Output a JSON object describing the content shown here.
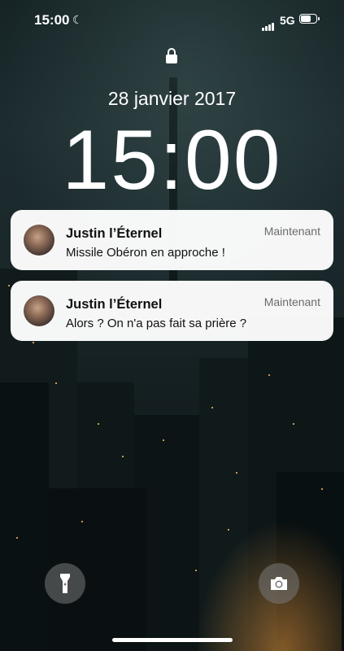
{
  "status_bar": {
    "time": "15:00",
    "network": "5G",
    "moon_icon": "moon-icon",
    "battery_level": 0.7
  },
  "lock_screen": {
    "date": "28 janvier 2017",
    "time": "15:00"
  },
  "notifications": [
    {
      "sender": "Justin l’Éternel",
      "message": "Missile Obéron en approche !",
      "time": "Maintenant"
    },
    {
      "sender": "Justin l’Éternel",
      "message": "Alors ? On n'a pas fait sa prière ?",
      "time": "Maintenant"
    }
  ],
  "quick_actions": {
    "left_icon": "flashlight-icon",
    "right_icon": "camera-icon"
  }
}
